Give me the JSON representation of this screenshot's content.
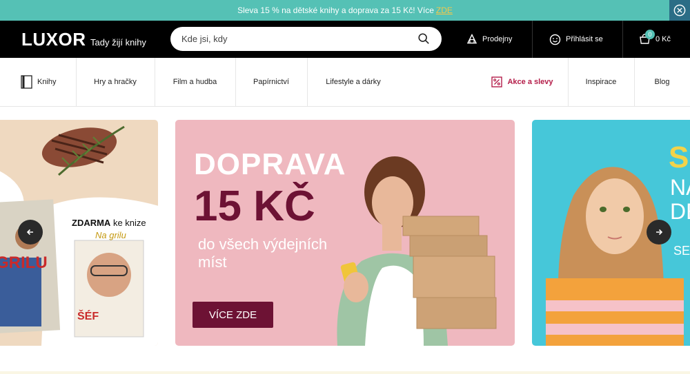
{
  "promo": {
    "text": "Sleva 15 % na dětské knihy a doprava za 15 Kč! Více",
    "link": "ZDE",
    "close_icon": "close-circle-icon"
  },
  "header": {
    "logo": "LUXOR",
    "tagline": "Tady žijí knihy",
    "search_placeholder": "Kde jsi, kdy",
    "stores_label": "Prodejny",
    "login_label": "Přihlásit se",
    "cart_count": "0",
    "cart_total": "0 Kč"
  },
  "nav": {
    "items": [
      {
        "label": "Knihy",
        "icon": "book-icon"
      },
      {
        "label": "Hry a hračky"
      },
      {
        "label": "Film a hudba"
      },
      {
        "label": "Papírnictví"
      },
      {
        "label": "Lifestyle a dárky"
      },
      {
        "label": "Akce a slevy",
        "icon": "percent-icon"
      },
      {
        "label": "Inspirace"
      },
      {
        "label": "Blog"
      }
    ]
  },
  "carousel": {
    "left": {
      "zdarma": "ZDARMA",
      "ke_knize": " ke knize",
      "na_grilu": "Na grilu",
      "book_text_1": "GRILU",
      "book_text_2": "ŠÉF"
    },
    "main": {
      "line1": "DOPRAVA",
      "line2": "15 KČ",
      "sub": "do všech výdejních míst",
      "cta": "VÍCE ZDE"
    },
    "right": {
      "letter1": "S",
      "letter2": "NA",
      "letter3": "DĚ",
      "letter4": "SE"
    }
  },
  "colors": {
    "promo_bg": "#55c1b5",
    "accent_burgundy": "#6d1234",
    "sale_red": "#b41d49"
  }
}
